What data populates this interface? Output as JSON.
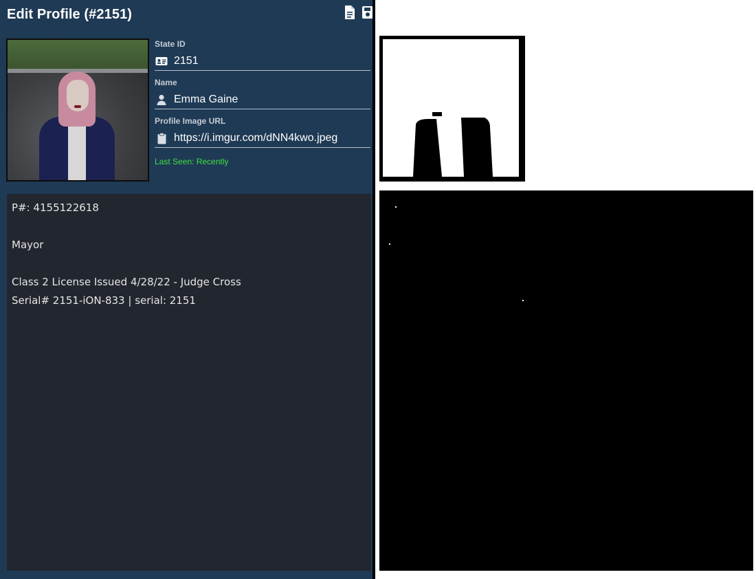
{
  "header": {
    "title": "Edit Profile (#2151)"
  },
  "toolbar": {
    "icons": [
      "document-icon",
      "save-icon"
    ]
  },
  "profile": {
    "state_id_label": "State ID",
    "state_id": "2151",
    "name_label": "Name",
    "name": "Emma Gaine",
    "image_url_label": "Profile Image URL",
    "image_url": "https://i.imgur.com/dNN4kwo.jpeg",
    "last_seen": "Last Seen: Recently"
  },
  "notes": {
    "lines": [
      "P#: 4155122618",
      "Mayor",
      "Class 2 License Issued 4/28/22 - Judge Cross",
      "Serial# 2151-iON-833 | serial: 2151"
    ]
  },
  "colors": {
    "panel_bg": "#1f3a55",
    "notes_bg": "#22262e",
    "last_seen": "#3fe03f"
  }
}
